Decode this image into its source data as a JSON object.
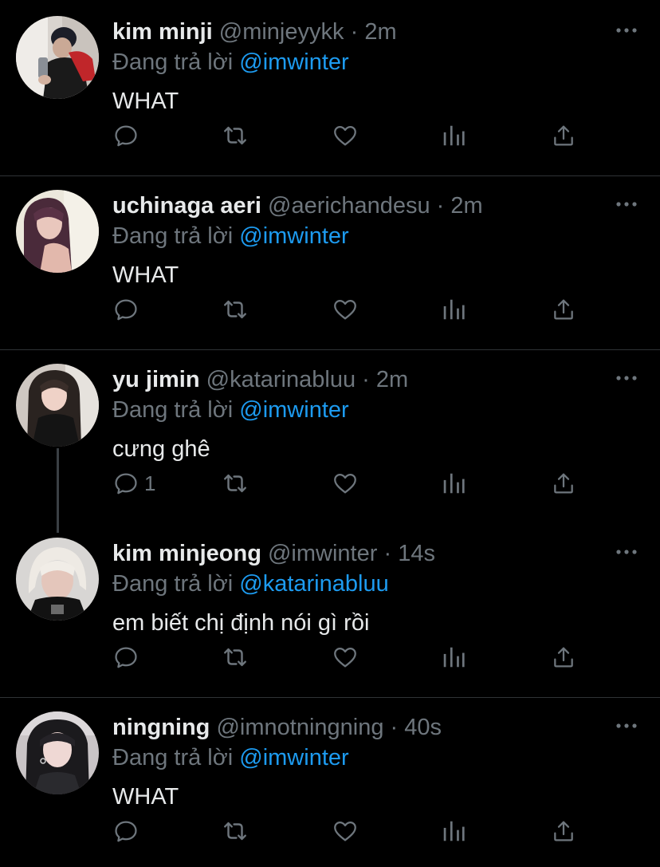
{
  "tweets": [
    {
      "name": "kim minji",
      "handle": "@minjeyykk",
      "time": "2m",
      "replying_prefix": "Đang trả lời",
      "replying_to": "@imwinter",
      "text": "WHAT",
      "reply_count": ""
    },
    {
      "name": "uchinaga aeri",
      "handle": "@aerichandesu",
      "time": "2m",
      "replying_prefix": "Đang trả lời",
      "replying_to": "@imwinter",
      "text": "WHAT",
      "reply_count": ""
    },
    {
      "name": "yu jimin",
      "handle": "@katarinabluu",
      "time": "2m",
      "replying_prefix": "Đang trả lời",
      "replying_to": "@imwinter",
      "text": "cưng ghê",
      "reply_count": "1"
    },
    {
      "name": "kim minjeong",
      "handle": "@imwinter",
      "time": "14s",
      "replying_prefix": "Đang trả lời",
      "replying_to": "@katarinabluu",
      "text": "em biết chị định nói gì rồi",
      "reply_count": ""
    },
    {
      "name": "ningning",
      "handle": "@imnotningning",
      "time": "40s",
      "replying_prefix": "Đang trả lời",
      "replying_to": "@imwinter",
      "text": "WHAT",
      "reply_count": ""
    }
  ],
  "meta_separator": "·",
  "icons": {
    "reply": "reply-icon",
    "retweet": "retweet-icon",
    "like": "heart-icon",
    "analytics": "analytics-icon",
    "share": "share-icon",
    "more": "more-icon"
  },
  "colors": {
    "background": "#000000",
    "text": "#e7e9ea",
    "muted": "#6e767d",
    "mention": "#1d9bf0",
    "divider": "#2f3336"
  }
}
